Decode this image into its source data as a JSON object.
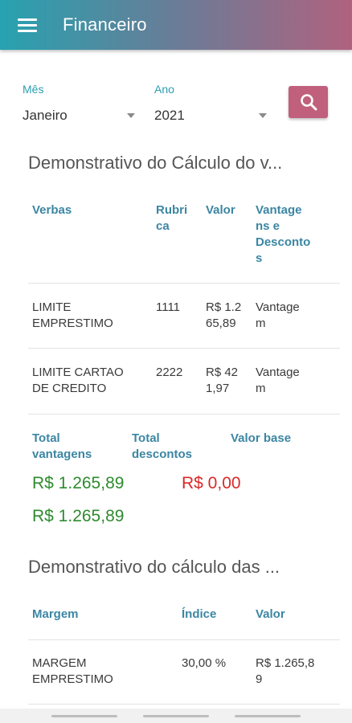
{
  "appbar": {
    "title": "Financeiro",
    "menu_icon": "hamburger-menu-icon"
  },
  "filters": {
    "month": {
      "label": "Mês",
      "value": "Janeiro"
    },
    "year": {
      "label": "Ano",
      "value": "2021"
    },
    "search_icon": "search-icon"
  },
  "calc": {
    "title": "Demonstrativo do Cálculo do v...",
    "headers": {
      "verbas": "Verbas",
      "rubrica_1": "Rubri",
      "rubrica_2": "ca",
      "valor": "Valor",
      "vant_1": "Vantage",
      "vant_2": "ns e",
      "vant_3": "Desconto",
      "vant_4": "s"
    },
    "rows": [
      {
        "verba_1": "LIMITE",
        "verba_2": "EMPRESTIMO",
        "rubrica": "1111",
        "valor_1": "R$ 1.2",
        "valor_2": "65,89",
        "tipo_1": "Vantage",
        "tipo_2": "m"
      },
      {
        "verba_1": "LIMITE CARTAO",
        "verba_2": "DE CREDITO",
        "rubrica": "2222",
        "valor_1": "R$ 42",
        "valor_2": "1,97",
        "tipo_1": "Vantage",
        "tipo_2": "m"
      }
    ]
  },
  "totals": {
    "vantagens_label_1": "Total",
    "vantagens_label_2": "vantagens",
    "descontos_label_1": "Total",
    "descontos_label_2": "descontos",
    "base_label": "Valor base",
    "vantagens_value": "R$ 1.265,89",
    "descontos_value": "R$ 0,00",
    "base_value": "R$ 1.265,89",
    "positive_color": "#2e8b2e",
    "negative_color": "#d82a2a"
  },
  "margem": {
    "title": "Demonstrativo do cálculo das ...",
    "headers": {
      "margem": "Margem",
      "indice": "Índice",
      "valor": "Valor"
    },
    "rows": [
      {
        "margem_1": "MARGEM",
        "margem_2": "EMPRESTIMO",
        "indice": "30,00 %",
        "valor_1": "R$ 1.265,8",
        "valor_2": "9"
      }
    ]
  }
}
